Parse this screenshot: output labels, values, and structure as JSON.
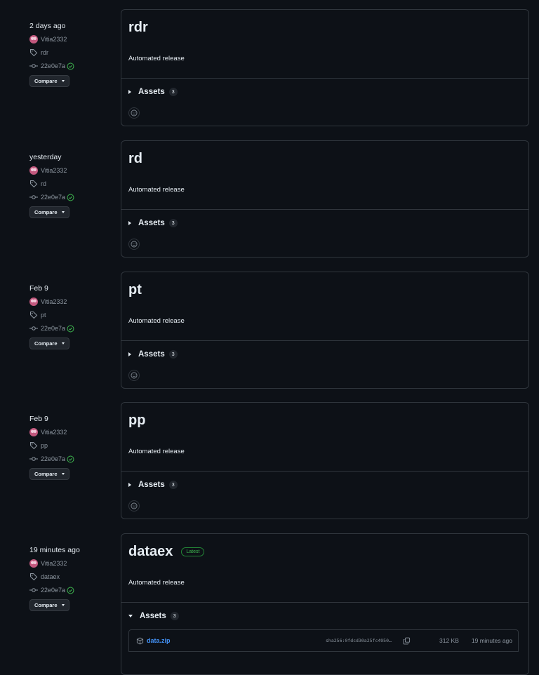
{
  "releases": [
    {
      "date": "2 days ago",
      "author": "Vitia2332",
      "tag": "rdr",
      "commit": "22e0e7a",
      "compare_label": "Compare",
      "title": "rdr",
      "description": "Automated release",
      "assets_label": "Assets",
      "assets_count": "3"
    },
    {
      "date": "yesterday",
      "author": "Vitia2332",
      "tag": "rd",
      "commit": "22e0e7a",
      "compare_label": "Compare",
      "title": "rd",
      "description": "Automated release",
      "assets_label": "Assets",
      "assets_count": "3"
    },
    {
      "date": "Feb 9",
      "author": "Vitia2332",
      "tag": "pt",
      "commit": "22e0e7a",
      "compare_label": "Compare",
      "title": "pt",
      "description": "Automated release",
      "assets_label": "Assets",
      "assets_count": "3"
    },
    {
      "date": "Feb 9",
      "author": "Vitia2332",
      "tag": "pp",
      "commit": "22e0e7a",
      "compare_label": "Compare",
      "title": "pp",
      "description": "Automated release",
      "assets_label": "Assets",
      "assets_count": "3"
    },
    {
      "date": "19 minutes ago",
      "author": "Vitia2332",
      "tag": "dataex",
      "commit": "22e0e7a",
      "compare_label": "Compare",
      "title": "dataex",
      "latest_label": "Latest",
      "description": "Automated release",
      "assets_label": "Assets",
      "assets_count": "3",
      "asset": {
        "name": "data.zip",
        "sha": "sha256:0fdcd30a25fc4950…",
        "size": "312 KB",
        "time": "19 minutes ago"
      }
    }
  ],
  "colors": {
    "background": "#0d1117",
    "border": "#30363d",
    "success": "#3fb950",
    "link": "#4493f8"
  }
}
